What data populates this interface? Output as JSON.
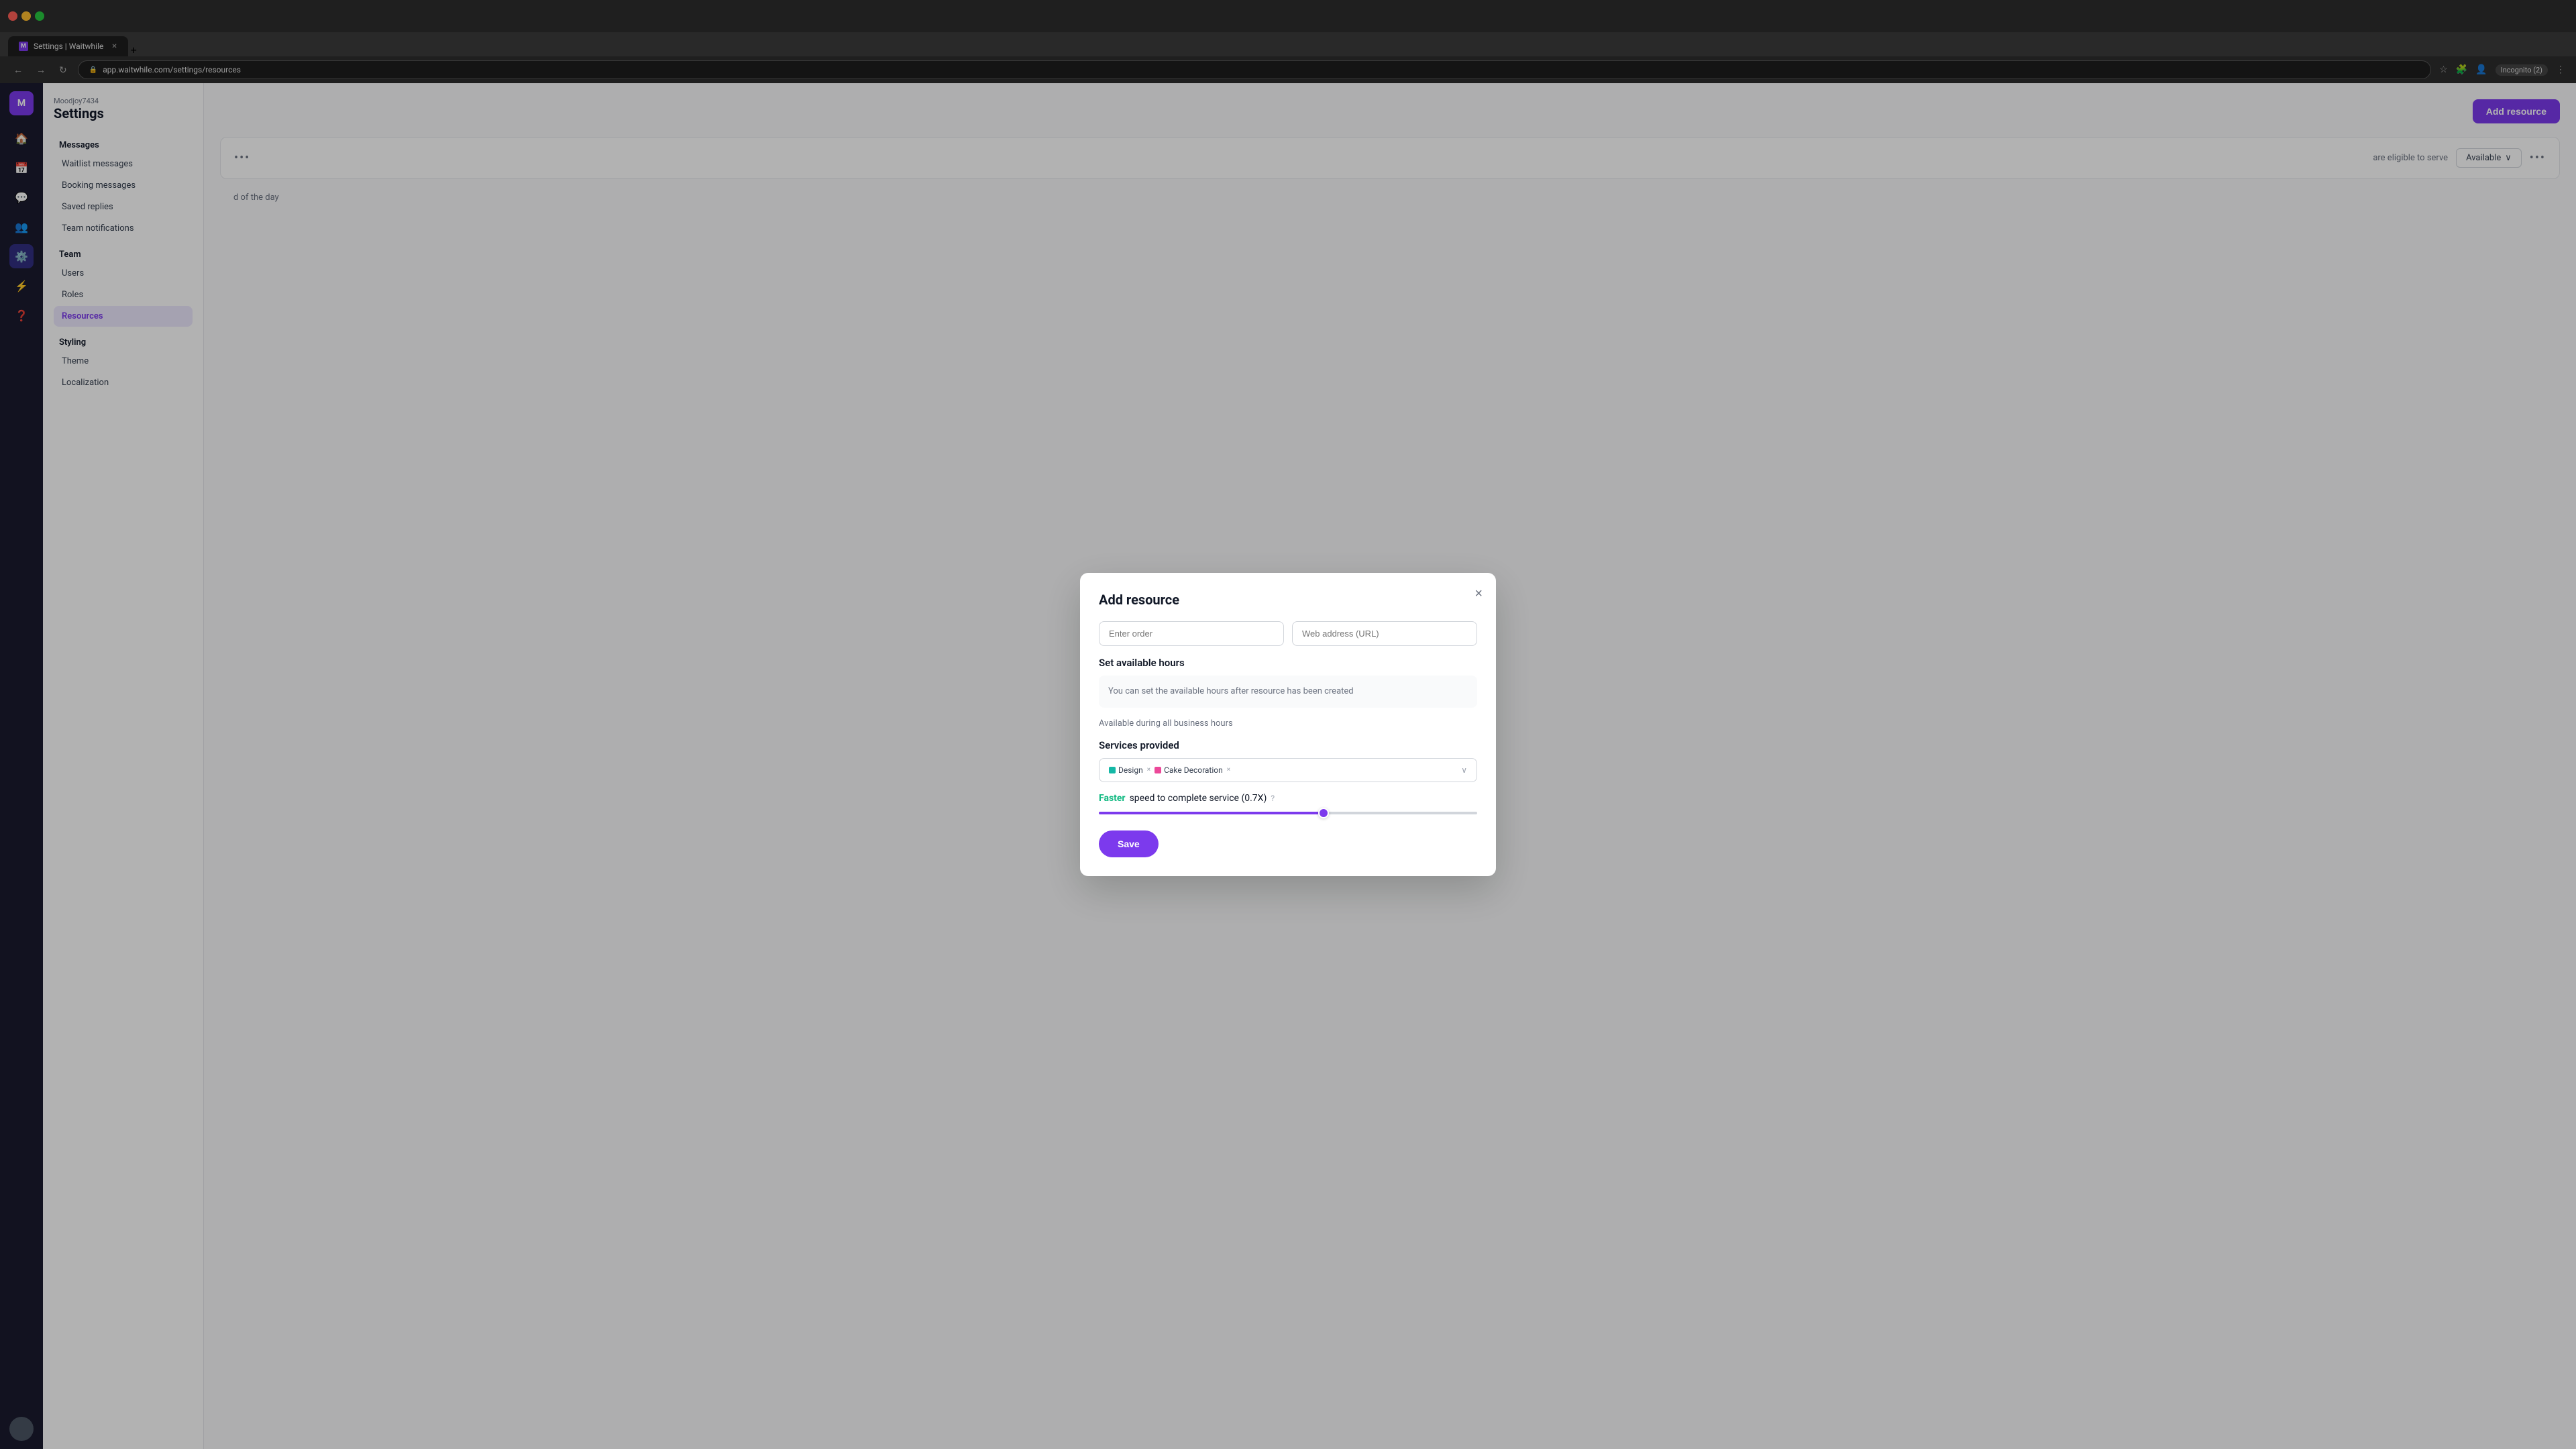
{
  "browser": {
    "tab_title": "Settings | Waitwhile",
    "url": "app.waitwhile.com/settings/resources",
    "incognito_label": "Incognito (2)",
    "favicon_letter": "M"
  },
  "sidebar": {
    "account_name": "Moodjoy7434",
    "page_title": "Settings",
    "avatar_letter": "M",
    "sections": [
      {
        "title": "Messages",
        "items": [
          {
            "label": "Waitlist messages",
            "active": false
          },
          {
            "label": "Booking messages",
            "active": false
          },
          {
            "label": "Saved replies",
            "active": false
          },
          {
            "label": "Team notifications",
            "active": false
          }
        ]
      },
      {
        "title": "Team",
        "items": [
          {
            "label": "Users",
            "active": false
          },
          {
            "label": "Roles",
            "active": false
          },
          {
            "label": "Resources",
            "active": true
          }
        ]
      },
      {
        "title": "Styling",
        "items": [
          {
            "label": "Theme",
            "active": false
          },
          {
            "label": "Localization",
            "active": false
          }
        ]
      }
    ]
  },
  "main": {
    "add_resource_label": "Add resource",
    "content_rows": [
      {
        "text": "are eligible to serve",
        "available_label": "Available",
        "end_of_day_text": "d of the day"
      }
    ]
  },
  "modal": {
    "title": "Add resource",
    "close_label": "×",
    "order_placeholder": "Enter order",
    "url_placeholder": "Web address (URL)",
    "set_hours_title": "Set available hours",
    "info_text": "You can set the available hours after resource has been created",
    "all_hours_label": "Available during all business hours",
    "services_title": "Services provided",
    "services": [
      {
        "name": "Design",
        "color": "teal",
        "remove": "×"
      },
      {
        "name": "Cake Decoration",
        "color": "pink",
        "remove": "×"
      }
    ],
    "speed_label_faster": "Faster",
    "speed_label_rest": " speed to complete service (0.7X)",
    "speed_help": "?",
    "slider_value": 60,
    "save_label": "Save"
  }
}
